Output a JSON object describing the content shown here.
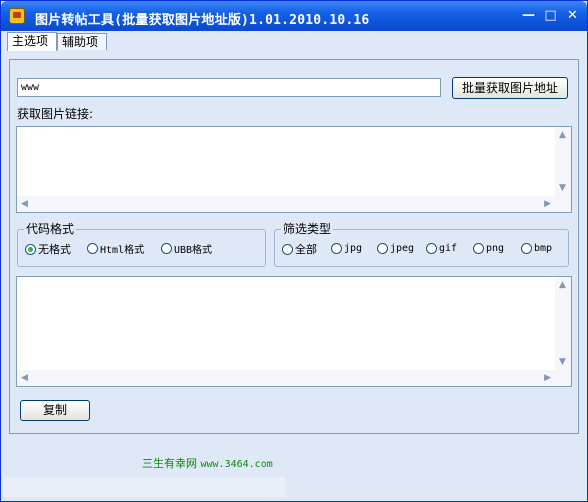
{
  "window": {
    "title": "图片转帖工具(批量获取图片地址版)1.01.2010.10.16",
    "min_glyph": "—",
    "max_glyph": "□",
    "close_glyph": "✕"
  },
  "tabs": [
    {
      "label": "主选项",
      "active": true
    },
    {
      "label": "辅助项",
      "active": false
    }
  ],
  "main": {
    "url_input_value": "www",
    "fetch_button_label": "批量获取图片地址",
    "links_label": "获取图片链接:",
    "code_format": {
      "legend": "代码格式",
      "options": [
        {
          "label": "无格式",
          "selected": true
        },
        {
          "label": "Html格式",
          "selected": false
        },
        {
          "label": "UBB格式",
          "selected": false
        }
      ]
    },
    "filter_type": {
      "legend": "筛选类型",
      "options": [
        {
          "label": "全部",
          "selected": false
        },
        {
          "label": "jpg",
          "selected": false
        },
        {
          "label": "jpeg",
          "selected": false
        },
        {
          "label": "gif",
          "selected": false
        },
        {
          "label": "png",
          "selected": false
        },
        {
          "label": "bmp",
          "selected": false
        }
      ]
    },
    "copy_button_label": "复制"
  },
  "footer": {
    "site_name": "三生有幸网",
    "site_url": "www.3464.com"
  },
  "colors": {
    "titlebar": "#0a49d2",
    "window_bg": "#dfe8f6",
    "footer_text": "#0a8a0a",
    "radio_selected": "#3fb03f"
  }
}
